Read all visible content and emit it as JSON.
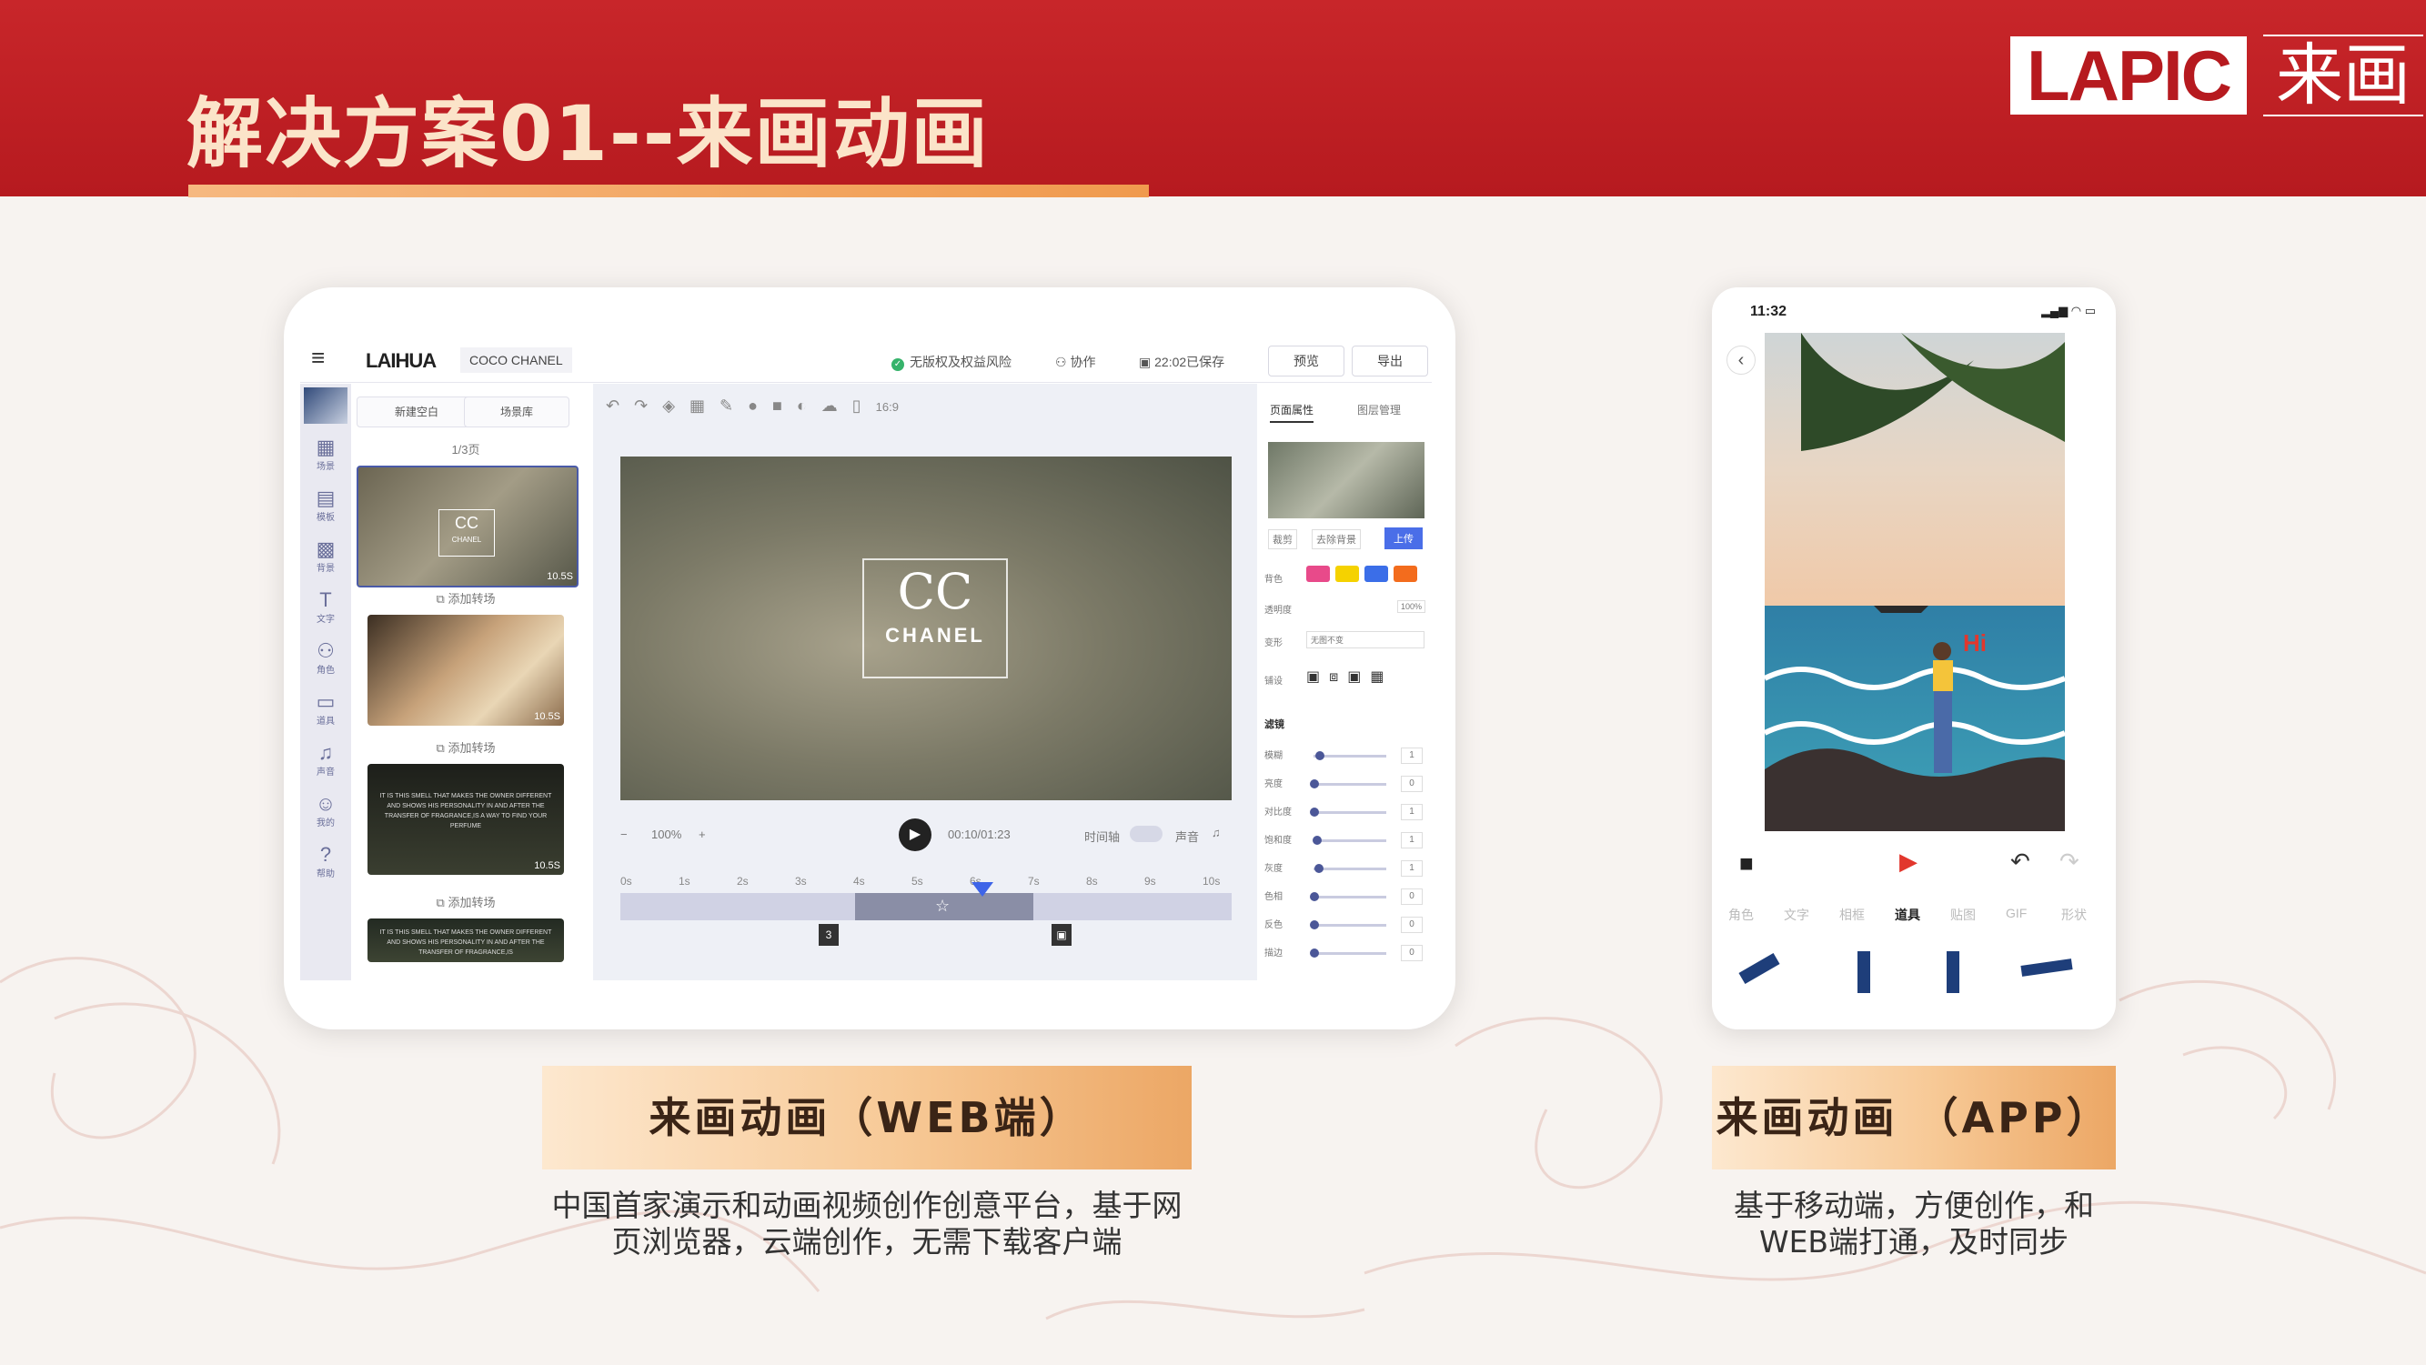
{
  "header": {
    "title": "解决方案01--来画动画",
    "logo_text": "LAPIC",
    "logo_cn": "来画"
  },
  "web_app": {
    "brand": "LAIHUA",
    "doc_name": "COCO CHANEL",
    "risk_text": "无版权及权益风险",
    "collab_text": "协作",
    "saved_text": "22:02已保存",
    "preview_btn": "预览",
    "export_btn": "导出",
    "sidebar": [
      {
        "icon": "template-icon",
        "glyph": "▦",
        "label": "场景"
      },
      {
        "icon": "model-icon",
        "glyph": "▤",
        "label": "模板"
      },
      {
        "icon": "background-icon",
        "glyph": "▩",
        "label": "背景"
      },
      {
        "icon": "text-icon",
        "glyph": "T",
        "label": "文字"
      },
      {
        "icon": "character-icon",
        "glyph": "⚇",
        "label": "角色"
      },
      {
        "icon": "props-icon",
        "glyph": "▭",
        "label": "道具"
      },
      {
        "icon": "music-icon",
        "glyph": "♫",
        "label": "声音"
      },
      {
        "icon": "user-icon",
        "glyph": "☺",
        "label": "我的"
      },
      {
        "icon": "help-icon",
        "glyph": "?",
        "label": "帮助"
      }
    ],
    "new_blank": "新建空白",
    "scene_lib": "场景库",
    "page_count": "1/3页",
    "add_transition": "添加转场",
    "slides": [
      {
        "duration": "10.5S",
        "text": ""
      },
      {
        "duration": "10.5S",
        "text": ""
      },
      {
        "duration": "10.5S",
        "text": "IT IS THIS SMELL THAT MAKES THE OWNER DIFFERENT AND SHOWS HIS PERSONALITY IN AND AFTER THE TRANSFER OF FRAGRANCE,IS A WAY TO FIND YOUR PERFUME"
      },
      {
        "duration": "",
        "text": "IT IS THIS SMELL THAT MAKES THE OWNER DIFFERENT AND SHOWS HIS PERSONALITY IN AND AFTER THE TRANSFER OF FRAGRANCE,IS"
      }
    ],
    "aspect": "16:9",
    "stage_brand": "CHANEL",
    "zoom": "100%",
    "timecode": "00:10/01:23",
    "timeline_label": "时间轴",
    "sound_label": "声音",
    "ticks": [
      "0s",
      "1s",
      "2s",
      "3s",
      "4s",
      "5s",
      "6s",
      "7s",
      "8s",
      "9s",
      "10s"
    ],
    "props_panel": {
      "tab1": "页面属性",
      "tab2": "图层管理",
      "crop": "裁剪",
      "remove_bg": "去除背景",
      "upload": "上传",
      "color_label": "背色",
      "opacity_label": "透明度",
      "opacity_value": "100%",
      "transform_label": "变形",
      "transform_value": "无图不变",
      "position_label": "铺设",
      "filter_title": "滤镜",
      "colors": [
        "#e84a8a",
        "#f5d200",
        "#3b6ee8",
        "#f36c1d"
      ],
      "filters": [
        {
          "k": "模糊",
          "v": "1",
          "pos": 0.08
        },
        {
          "k": "亮度",
          "v": "0",
          "pos": 0.0
        },
        {
          "k": "对比度",
          "v": "1",
          "pos": 0.0
        },
        {
          "k": "饱和度",
          "v": "1",
          "pos": 0.04
        },
        {
          "k": "灰度",
          "v": "1",
          "pos": 0.06
        },
        {
          "k": "色相",
          "v": "0",
          "pos": 0.0
        },
        {
          "k": "反色",
          "v": "0",
          "pos": 0.0
        },
        {
          "k": "描边",
          "v": "0",
          "pos": 0.0
        }
      ]
    }
  },
  "phone_app": {
    "time": "11:32",
    "tabs": [
      "角色",
      "文字",
      "相框",
      "道具",
      "贴图",
      "GIF",
      "形状"
    ],
    "active_tab": "道具",
    "bubble_text": "Hi"
  },
  "labels": {
    "web_label": "来画动画（WEB端）",
    "app_label": "来画动画 （APP）",
    "web_desc_1": "中国首家演示和动画视频创作创意平台，基于网",
    "web_desc_2": "页浏览器，云端创作，无需下载客户端",
    "app_desc_1": "基于移动端，方便创作，和",
    "app_desc_2": "WEB端打通，及时同步"
  }
}
